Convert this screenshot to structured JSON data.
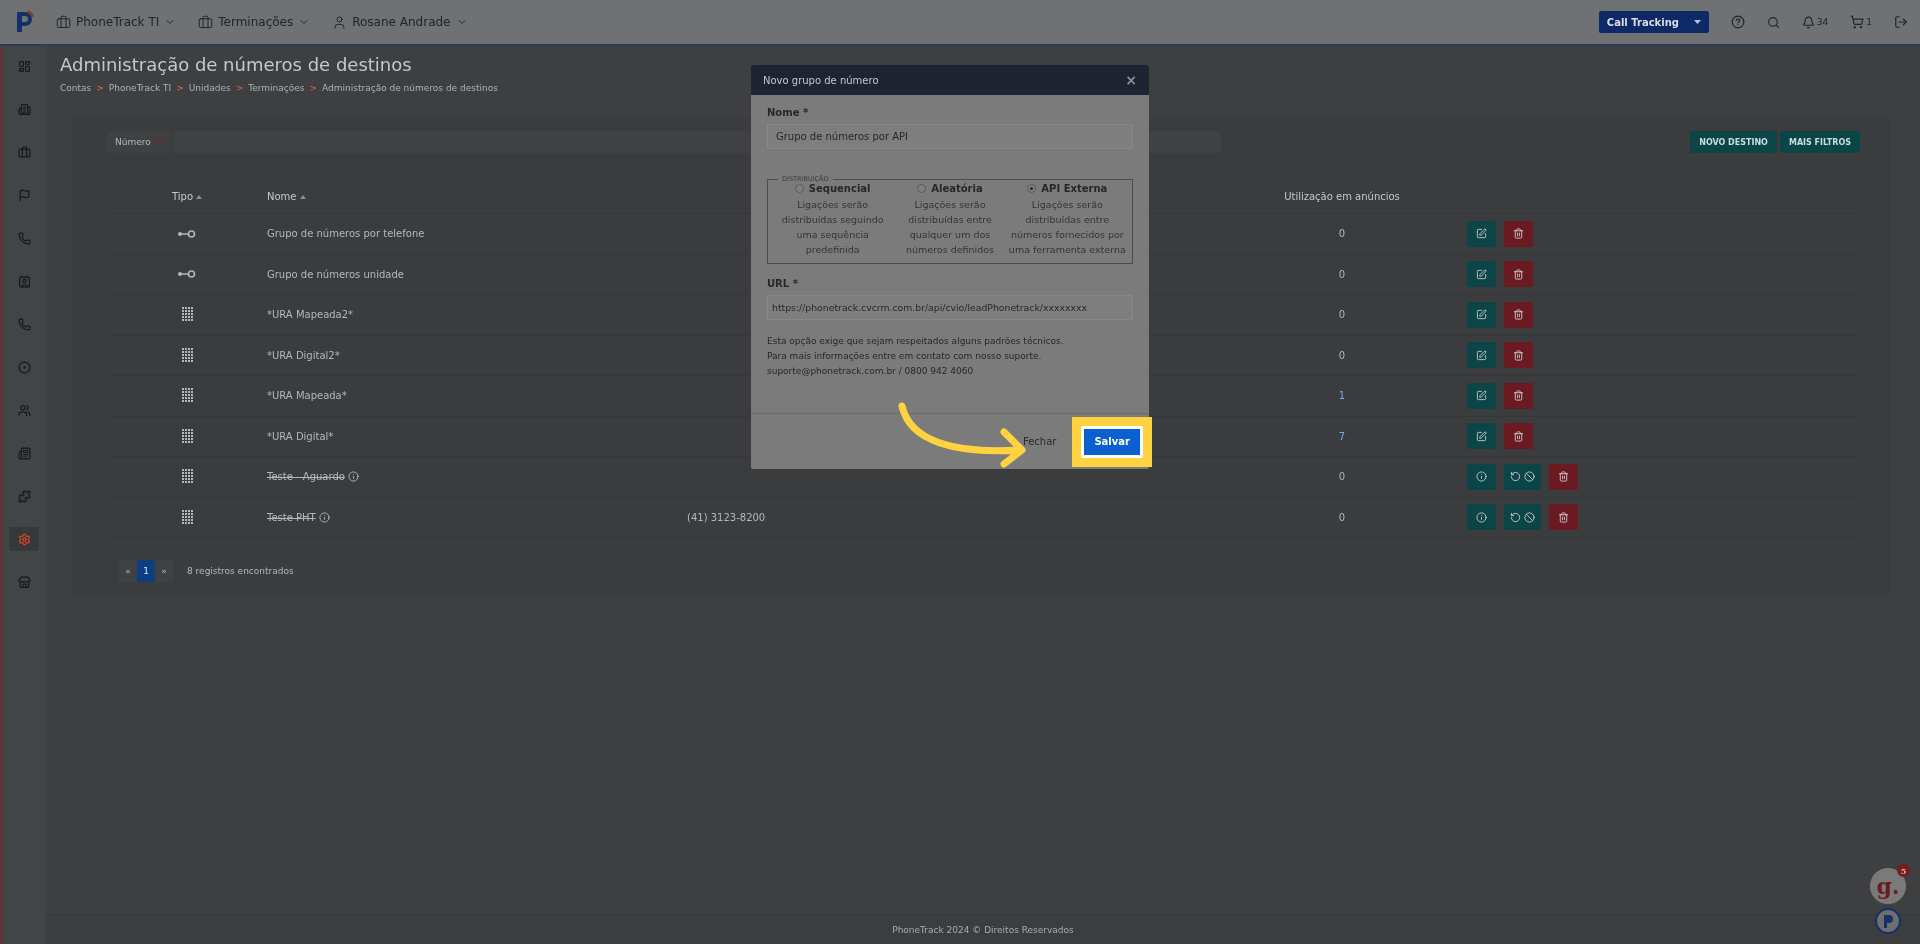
{
  "topbar": {
    "menus": [
      {
        "label": "PhoneTrack TI"
      },
      {
        "label": "Terminações"
      },
      {
        "label": "Rosane Andrade"
      }
    ],
    "product_select": "Call Tracking",
    "notifications": "34",
    "cart": "1"
  },
  "sidebar": {
    "items": [
      {
        "selected": false
      },
      {
        "selected": false
      },
      {
        "selected": false
      },
      {
        "selected": false
      },
      {
        "selected": false
      },
      {
        "selected": false
      },
      {
        "selected": false
      },
      {
        "selected": false
      },
      {
        "selected": false
      },
      {
        "selected": false
      },
      {
        "selected": false
      },
      {
        "selected": true
      },
      {
        "selected": false
      }
    ]
  },
  "page": {
    "title": "Administração de números de destinos",
    "breadcrumb": [
      "Contas",
      "PhoneTrack TI",
      "Unidades",
      "Terminações",
      "Administração de números de destinos"
    ],
    "breadcrumb_separator": ">",
    "filter": {
      "label": "Número"
    },
    "buttons": [
      "NOVO DESTINO",
      "MAIS FILTROS"
    ]
  },
  "table": {
    "columns": [
      {
        "label": "Tipo",
        "sortable": true
      },
      {
        "label": "Nome",
        "sortable": true
      },
      {
        "label": "Utilização em anúncios",
        "sortable": false
      }
    ],
    "rows": [
      {
        "kind": "group",
        "name": "Grupo de números por telefone",
        "usage": "0",
        "usage_linked": false,
        "disabled": false
      },
      {
        "kind": "group",
        "name": "Grupo de números unidade",
        "usage": "0",
        "usage_linked": false,
        "disabled": false
      },
      {
        "kind": "ura",
        "name": "*URA Mapeada2*",
        "usage": "0",
        "usage_linked": false,
        "disabled": false
      },
      {
        "kind": "ura",
        "name": "*URA Digital2*",
        "usage": "0",
        "usage_linked": false,
        "disabled": false
      },
      {
        "kind": "ura",
        "name": "*URA Mapeada*",
        "usage": "1",
        "usage_linked": true,
        "disabled": false
      },
      {
        "kind": "ura",
        "name": "*URA Digital*",
        "usage": "7",
        "usage_linked": true,
        "disabled": false
      },
      {
        "kind": "ura",
        "name": "Teste - Aguardo",
        "usage": "0",
        "usage_linked": false,
        "disabled": true
      },
      {
        "kind": "ura",
        "name": "Teste PHT",
        "column_3": "(41) 3123-8200",
        "usage": "0",
        "usage_linked": false,
        "disabled": true
      }
    ]
  },
  "pagination": {
    "prev": "«",
    "pages": [
      {
        "label": "1",
        "selected": true
      }
    ],
    "next": "»",
    "summary": "8 registros encontrados"
  },
  "modal": {
    "title": "Novo grupo de número",
    "close": "×",
    "name_label": "Nome *",
    "name_value": "Grupo de números por API",
    "distribution_legend": "DISTRIBUIÇÃO",
    "options": [
      {
        "label": "Sequencial",
        "description": "Ligações serão distribuídas seguindo uma sequência predefinida",
        "selected": false
      },
      {
        "label": "Aleatória",
        "description": "Ligações serão distribuídas entre qualquer um dos números definidos",
        "selected": false
      },
      {
        "label": "API Externa",
        "description": "Ligações serão distribuídas entre números fornecidos por uma ferramenta externa",
        "selected": true
      }
    ],
    "url_label": "URL *",
    "url_value": "https://phonetrack.cvcrm.com.br/api/cvio/leadPhonetrack/xxxxxxxx",
    "help": [
      "Esta opção exige que sejam respeitados alguns padrões técnicos.",
      "Para mais informações entre em contato com nosso suporte.",
      "suporte@phonetrack.com.br / 0800 942 4060"
    ],
    "close_button": "Fechar",
    "save_button": "Salvar"
  },
  "footer": "PhoneTrack 2024 © Direitos Reservados",
  "helper_widget": {
    "label": "g.",
    "count": "5"
  }
}
